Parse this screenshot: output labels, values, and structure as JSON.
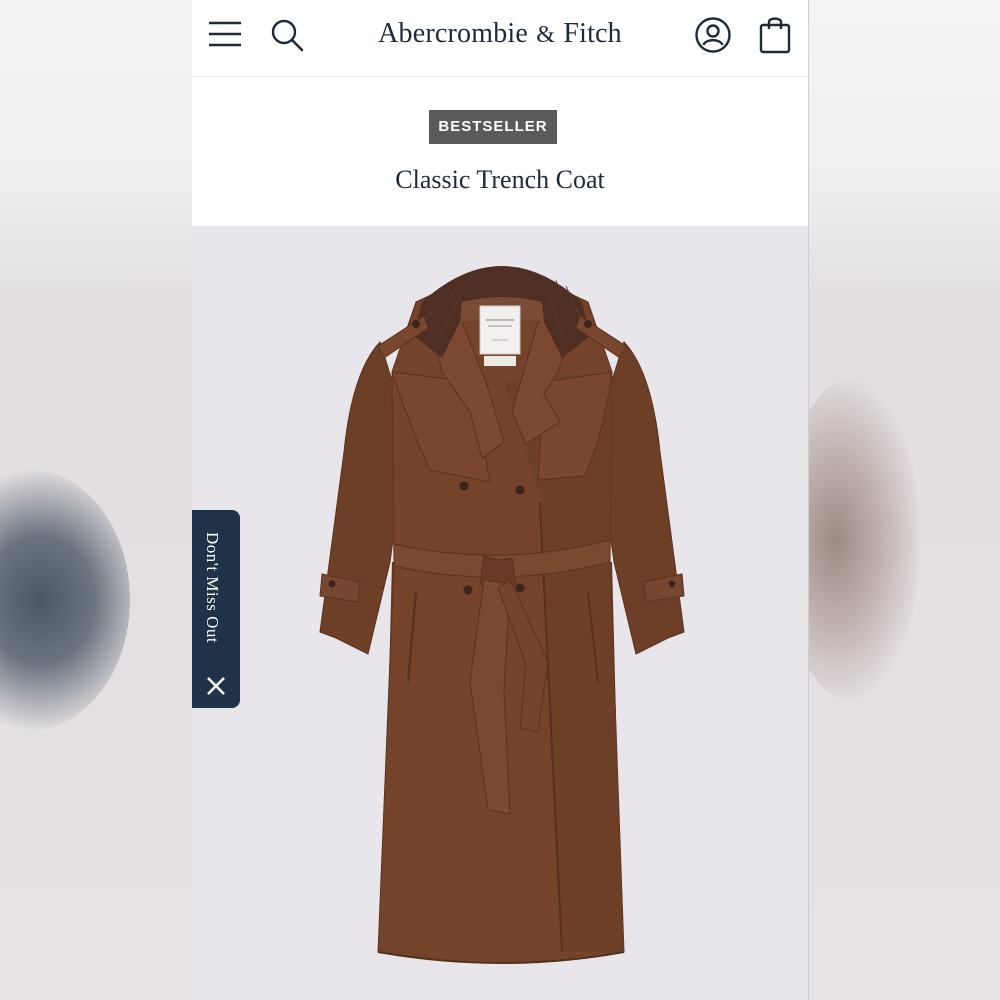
{
  "header": {
    "brand_main": "Abercrombie",
    "brand_amp": "&",
    "brand_end": "Fitch",
    "icons": [
      "menu-icon",
      "search-icon",
      "account-icon",
      "shopping-bag-icon"
    ]
  },
  "product": {
    "badge": "BESTSELLER",
    "title": "Classic Trench Coat",
    "image_alt": "Brown trench coat with corduroy collar and belt",
    "colors": {
      "coat": "#6e3f27",
      "collar": "#4f2e24"
    }
  },
  "promo_tab": {
    "label": "Don't Miss Out",
    "close_icon": "close-icon",
    "background": "#1f3248"
  },
  "colors": {
    "text_primary": "#1e2a3a",
    "badge_background": "#5a5a5c",
    "image_background": "#e8e6ea"
  }
}
